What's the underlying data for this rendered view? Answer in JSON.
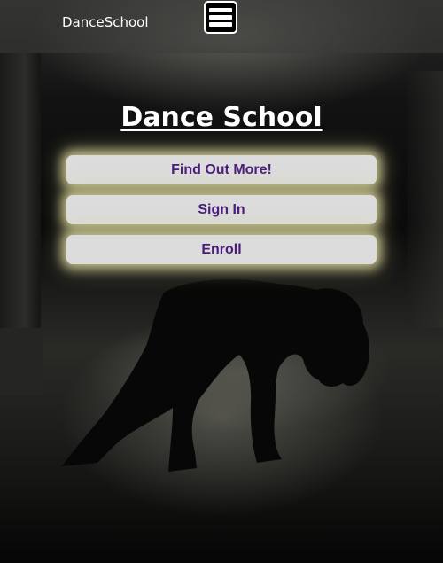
{
  "header": {
    "brand": "DanceSchool",
    "menu_icon": "hamburger-menu-icon"
  },
  "hero": {
    "title": "Dance School",
    "buttons": [
      {
        "label": "Find Out More!"
      },
      {
        "label": "Sign In"
      },
      {
        "label": "Enroll"
      }
    ]
  },
  "colors": {
    "button_text": "#4b1c7d",
    "button_bg": "#dcdcdc",
    "button_glow": "#ece8aa",
    "title": "#ffffff"
  }
}
